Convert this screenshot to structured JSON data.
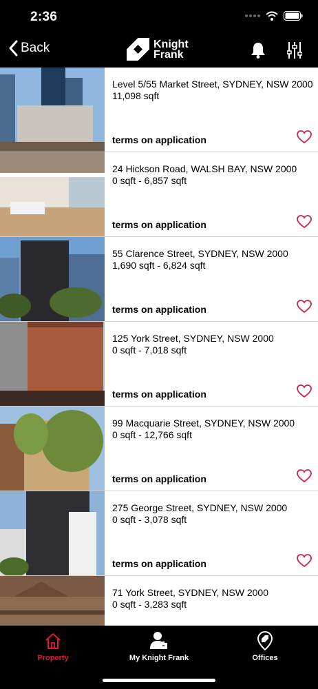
{
  "status": {
    "time": "2:36"
  },
  "nav": {
    "back_label": "Back",
    "logo_line1": "Knight",
    "logo_line2": "Frank"
  },
  "listings": [
    {
      "address": "Level 5/55 Market Street, SYDNEY, NSW 2000",
      "area": "11,098 sqft",
      "terms": "terms on application"
    },
    {
      "address": "24 Hickson Road, WALSH BAY, NSW 2000",
      "area": "0 sqft - 6,857 sqft",
      "terms": "terms on application"
    },
    {
      "address": "55 Clarence Street, SYDNEY, NSW 2000",
      "area": "1,690 sqft - 6,824 sqft",
      "terms": "terms on application"
    },
    {
      "address": "125 York Street, SYDNEY, NSW 2000",
      "area": "0 sqft - 7,018 sqft",
      "terms": "terms on application"
    },
    {
      "address": "99 Macquarie Street, SYDNEY, NSW 2000",
      "area": "0 sqft - 12,766 sqft",
      "terms": "terms on application"
    },
    {
      "address": "275 George Street, SYDNEY, NSW 2000",
      "area": "0 sqft - 3,078 sqft",
      "terms": "terms on application"
    },
    {
      "address": "71 York Street, SYDNEY, NSW 2000",
      "area": "0 sqft - 3,283 sqft",
      "terms": ""
    }
  ],
  "tabs": [
    {
      "label": "Property",
      "icon": "house-icon",
      "active": true
    },
    {
      "label": "My Knight Frank",
      "icon": "user-briefcase-icon",
      "active": false
    },
    {
      "label": "Offices",
      "icon": "map-pin-icon",
      "active": false
    }
  ],
  "colors": {
    "accent": "#d21f4d",
    "active_tab": "#e0173c",
    "background": "#000000"
  }
}
